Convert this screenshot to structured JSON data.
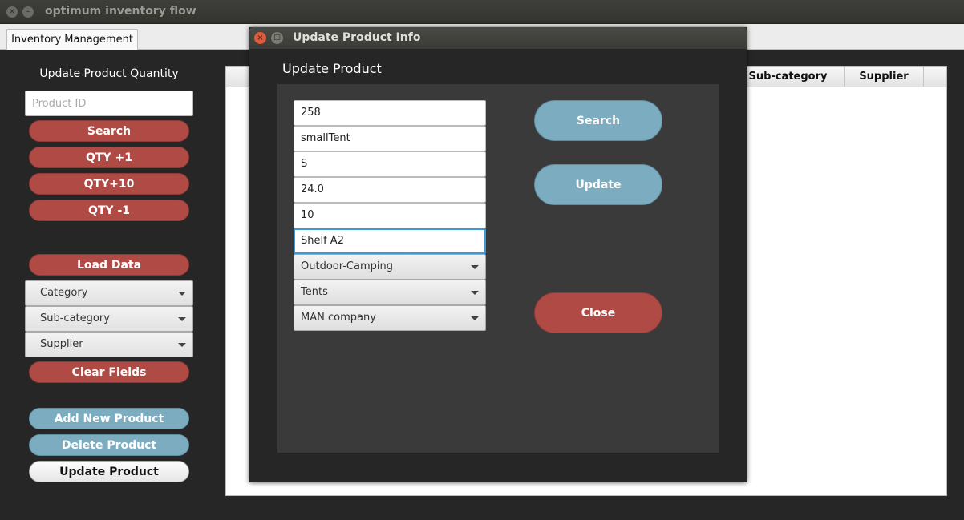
{
  "window": {
    "title": "optimum inventory flow",
    "close_icon": "×",
    "min_icon": "–"
  },
  "tabs": [
    {
      "label": "Inventory Management"
    }
  ],
  "sidebar": {
    "heading": "Update Product Quantity",
    "product_id_placeholder": "Product ID",
    "search_label": "Search",
    "qty_plus1_label": "QTY +1",
    "qty_plus10_label": "QTY+10",
    "qty_minus1_label": "QTY -1",
    "load_data_label": "Load Data",
    "category_label": "Category",
    "subcategory_label": "Sub-category",
    "supplier_label": "Supplier",
    "clear_fields_label": "Clear Fields",
    "add_product_label": "Add New Product",
    "delete_product_label": "Delete Product",
    "update_product_label": "Update Product"
  },
  "table": {
    "columns": [
      "Sub-category",
      "Supplier"
    ]
  },
  "dialog": {
    "title": "Update Product Info",
    "heading": "Update Product",
    "close_icon": "×",
    "min_icon": "□",
    "fields": {
      "id": "258",
      "name": "smallTent",
      "size": "S",
      "price": "24.0",
      "quantity": "10",
      "location": "Shelf A2",
      "category": "Outdoor-Camping",
      "subcategory": "Tents",
      "supplier": "MAN company"
    },
    "search_label": "Search",
    "update_label": "Update",
    "close_label": "Close"
  },
  "colors": {
    "red_button": "#b04a45",
    "blue_button": "#7bacc0",
    "focus": "#3d9ad6"
  }
}
